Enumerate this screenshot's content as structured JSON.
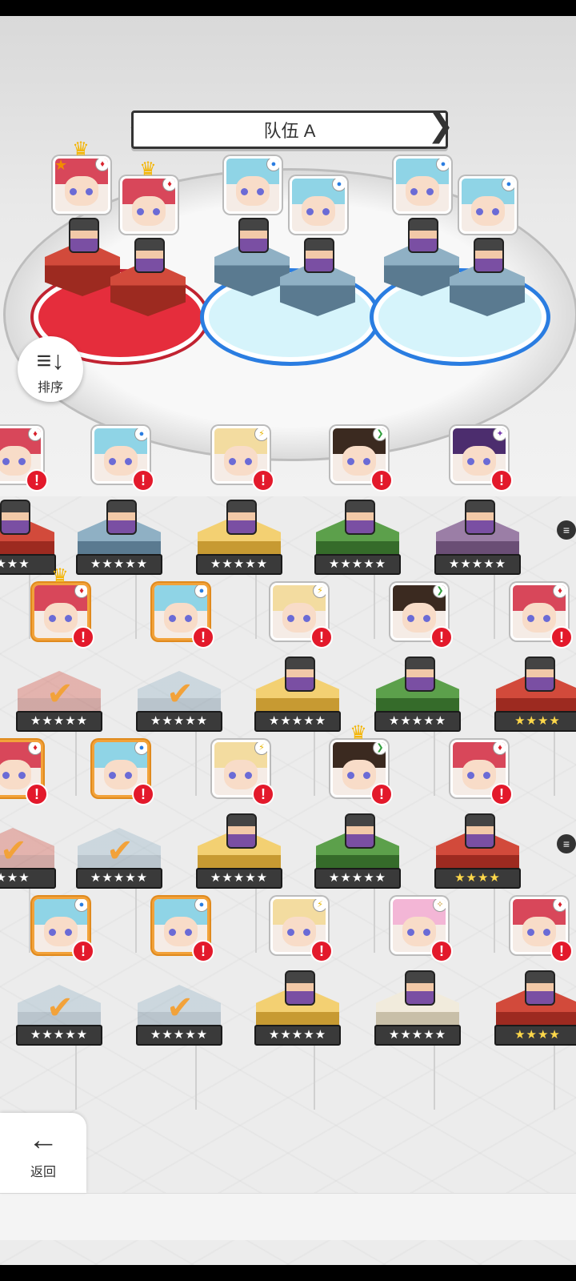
{
  "team": {
    "title": "队伍 A",
    "prev_arrow": "❮",
    "next_arrow": "❯"
  },
  "sort": {
    "label": "排序",
    "icon": "sort-icon"
  },
  "back": {
    "label": "返回",
    "icon": "arrow-left-icon"
  },
  "colors": {
    "red_team_platform": "#e52d3c",
    "blue_team_platform": "#2a7de1",
    "selected_border": "#f2a23a",
    "alert": "#e3192b"
  },
  "team_slots": [
    {
      "element": "red",
      "symbol": "♦",
      "leader": true,
      "crown": true
    },
    {
      "element": "red",
      "symbol": "♦",
      "leader": false,
      "crown": true
    },
    {
      "element": "blue",
      "symbol": "●",
      "leader": false,
      "crown": false
    },
    {
      "element": "blue",
      "symbol": "●",
      "leader": false,
      "crown": false
    },
    {
      "element": "blue",
      "symbol": "●",
      "leader": false,
      "crown": false
    },
    {
      "element": "blue",
      "symbol": "●",
      "leader": false,
      "crown": false
    }
  ],
  "roster": [
    {
      "element": "red",
      "symbol": "♦",
      "stars": "★★★",
      "pedestal": "red"
    },
    {
      "element": "blue",
      "symbol": "●",
      "stars": "★★★★★",
      "pedestal": "blue"
    },
    {
      "element": "yellow",
      "symbol": "⚡",
      "stars": "★★★★★",
      "pedestal": "yellow"
    },
    {
      "element": "green",
      "symbol": "❯",
      "stars": "★★★★★",
      "pedestal": "green"
    },
    {
      "element": "purple",
      "symbol": "✦",
      "stars": "★★★★★",
      "pedestal": "purple"
    },
    {
      "element": "red",
      "symbol": "♦",
      "stars": "★★★★★",
      "selected": true,
      "crown": true,
      "pedestal": "red"
    },
    {
      "element": "blue",
      "symbol": "●",
      "stars": "★★★★★",
      "selected": true,
      "pedestal": "blue"
    },
    {
      "element": "yellow",
      "symbol": "⚡",
      "stars": "★★★★★",
      "pedestal": "yellow"
    },
    {
      "element": "green",
      "symbol": "❯",
      "stars": "★★★★★",
      "pedestal": "green"
    },
    {
      "element": "red",
      "symbol": "♦",
      "stars": "★★★★",
      "pedestal": "red"
    },
    {
      "element": "red",
      "symbol": "♦",
      "stars": "★★★",
      "selected": true,
      "pedestal": "red"
    },
    {
      "element": "blue",
      "symbol": "●",
      "stars": "★★★★★",
      "selected": true,
      "pedestal": "blue"
    },
    {
      "element": "yellow",
      "symbol": "⚡",
      "stars": "★★★★★",
      "pedestal": "yellow"
    },
    {
      "element": "green",
      "symbol": "❯",
      "stars": "★★★★★",
      "crown": true,
      "pedestal": "green"
    },
    {
      "element": "red",
      "symbol": "♦",
      "stars": "★★★★",
      "pedestal": "red"
    },
    {
      "element": "blue",
      "symbol": "●",
      "stars": "★★★★★",
      "selected": true,
      "pedestal": "blue"
    },
    {
      "element": "blue",
      "symbol": "●",
      "stars": "★★★★★",
      "selected": true,
      "pedestal": "blue"
    },
    {
      "element": "yellow",
      "symbol": "⚡",
      "stars": "★★★★★",
      "pedestal": "yellow"
    },
    {
      "element": "light",
      "symbol": "✧",
      "stars": "★★★★★",
      "pedestal": "white"
    },
    {
      "element": "red",
      "symbol": "♦",
      "stars": "★★★★",
      "pedestal": "red"
    }
  ],
  "alert_glyph": "!",
  "check_glyph": "✔",
  "side_chip_glyph": "≡"
}
